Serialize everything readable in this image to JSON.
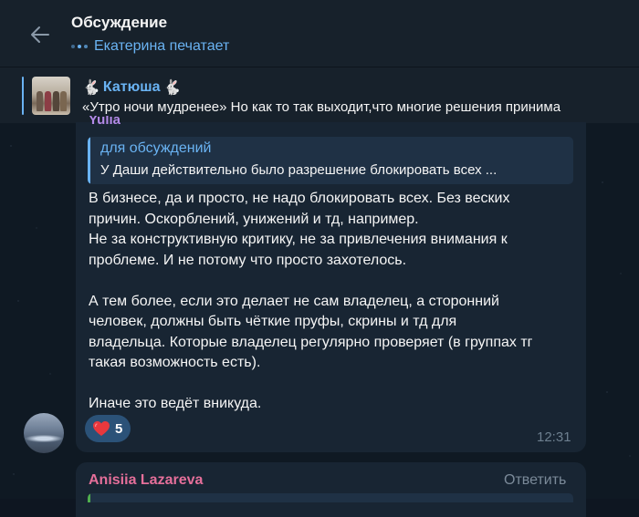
{
  "header": {
    "title": "Обсуждение",
    "status": "Екатерина печатает"
  },
  "pinned": {
    "name_prefix": "🐇",
    "name": "Катюша",
    "name_suffix": "🐇",
    "text": "«Утро ночи мудренее»  Но как то так выходит,что многие решения принима"
  },
  "message": {
    "sender": "Yulia",
    "reply_title": "для обсуждений",
    "reply_text": "У Даши действительно было разрешение блокировать всех ...",
    "text": "В бизнесе, да и просто, не надо блокировать всех. Без веских\nпричин. Оскорблений, унижений и тд, например.\nНе за конструктивную критику, не за привлечения внимания к\nпроблеме. И не потому что просто захотелось.\n\nА тем более, если это делает не сам владелец, а сторонний\nчеловек, должны быть чёткие пруфы, скрины и тд для\nвладельца. Которые владелец регулярно проверяет (в группах тг\nтакая возможность есть).\n\nИначе это ведёт вникуда.",
    "reaction_icon": "heart-icon",
    "reaction_count": "5",
    "time": "12:31"
  },
  "next_message": {
    "sender": "Anisiia Lazareva",
    "reply_label": "Ответить"
  },
  "colors": {
    "background": "#0e1621",
    "header": "#17212b",
    "bubble": "#182533",
    "accent": "#6ab3f3",
    "sender_yulia": "#b38ae8",
    "sender_anisiia": "#e56f9a",
    "reaction_bg": "#2b5278"
  }
}
